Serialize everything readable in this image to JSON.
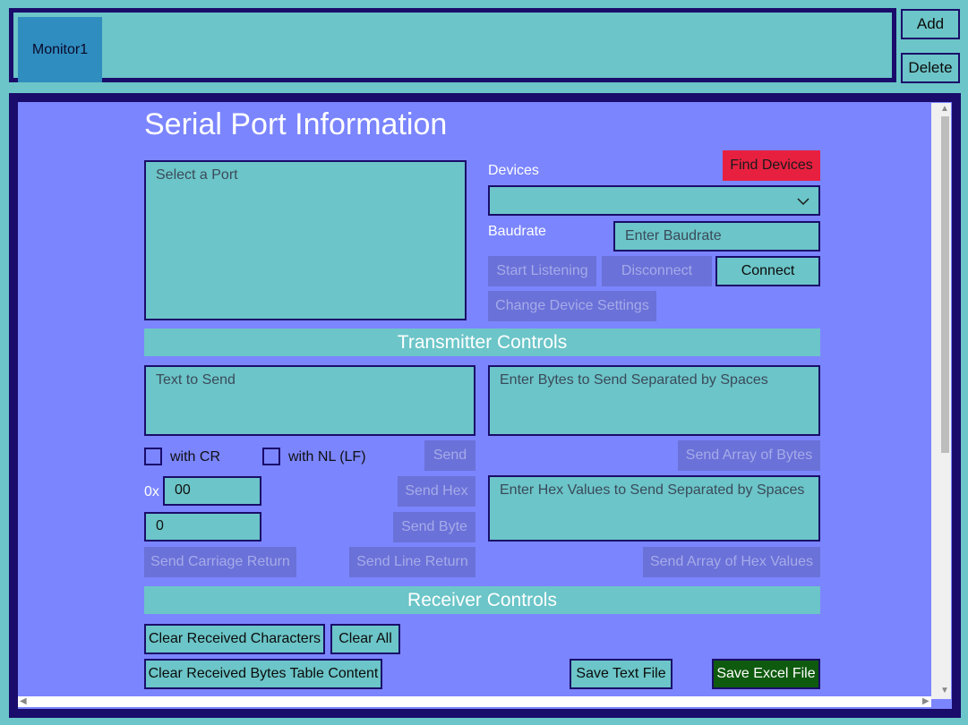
{
  "tabs": [
    {
      "label": "Monitor1"
    }
  ],
  "top_buttons": {
    "add": "Add",
    "delete": "Delete"
  },
  "page": {
    "title": "Serial Port Information"
  },
  "port_list": {
    "placeholder": "Select a Port"
  },
  "devices": {
    "label": "Devices",
    "find_button": "Find Devices",
    "selected": ""
  },
  "baudrate": {
    "label": "Baudrate",
    "placeholder": "Enter Baudrate"
  },
  "connection": {
    "start_listening": "Start Listening",
    "disconnect": "Disconnect",
    "connect": "Connect",
    "change_settings": "Change Device Settings"
  },
  "transmitter": {
    "header": "Transmitter Controls",
    "text_placeholder": "Text to Send",
    "bytes_placeholder": "Enter Bytes to Send Separated by Spaces",
    "with_cr": "with CR",
    "with_nl": "with NL (LF)",
    "send": "Send",
    "send_array_bytes": "Send Array of Bytes",
    "hex_prefix": "0x",
    "hex_value": "00",
    "send_hex": "Send Hex",
    "hex_values_placeholder": "Enter Hex Values to Send Separated by Spaces",
    "byte_value": "0",
    "send_byte": "Send Byte",
    "send_cr": "Send Carriage Return",
    "send_lr": "Send Line Return",
    "send_array_hex": "Send Array of Hex Values"
  },
  "receiver": {
    "header": "Receiver Controls",
    "clear_chars": "Clear Received Characters",
    "clear_all": "Clear All",
    "clear_bytes_table": "Clear Received Bytes Table Content",
    "save_text": "Save Text File",
    "save_excel": "Save Excel File"
  },
  "colors": {
    "background": "#6cc5c8",
    "frame": "#1a0c6a",
    "panel": "#7b85fe",
    "find_devices": "#e82040",
    "save_excel": "#0e5a0e"
  },
  "icons": {
    "dropdown": "chevron-down-icon"
  }
}
